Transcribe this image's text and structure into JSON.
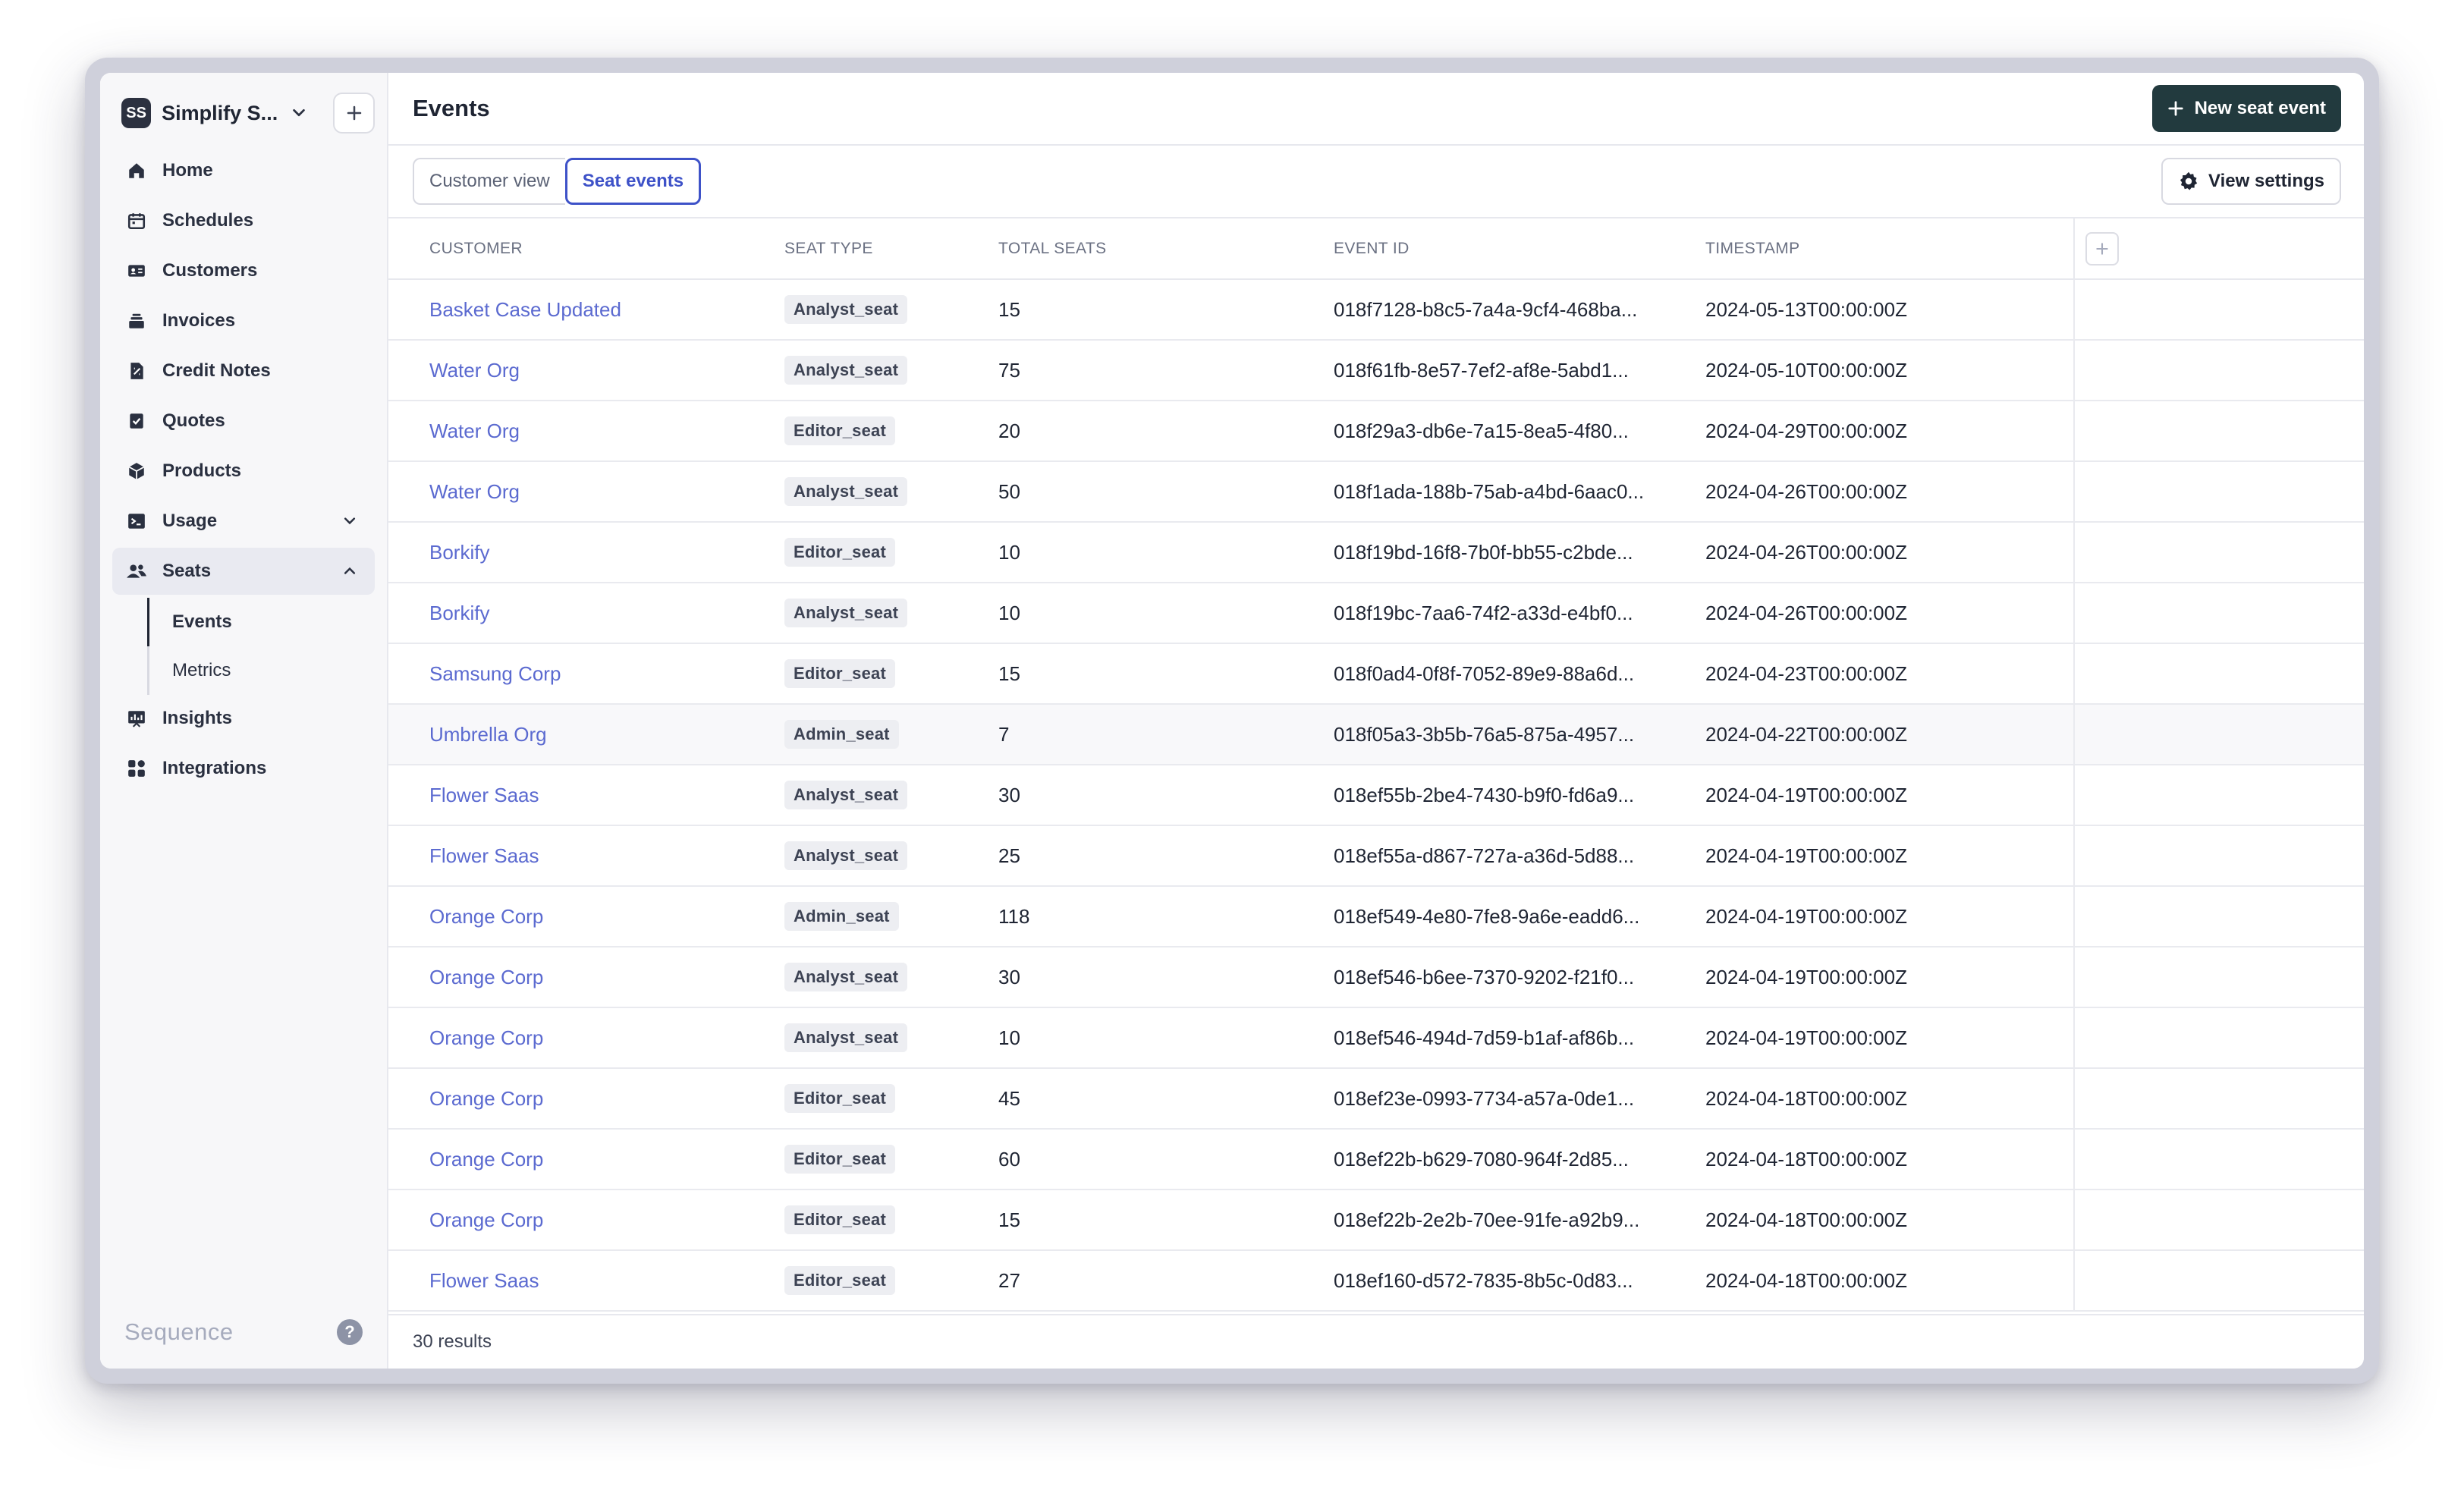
{
  "sidebar": {
    "org": {
      "initials": "SS",
      "name": "Simplify S..."
    },
    "items": [
      {
        "label": "Home",
        "icon": "home-icon"
      },
      {
        "label": "Schedules",
        "icon": "calendar-icon"
      },
      {
        "label": "Customers",
        "icon": "id-card-icon"
      },
      {
        "label": "Invoices",
        "icon": "invoice-stack-icon"
      },
      {
        "label": "Credit Notes",
        "icon": "credit-note-icon"
      },
      {
        "label": "Quotes",
        "icon": "quote-check-icon"
      },
      {
        "label": "Products",
        "icon": "box-icon"
      },
      {
        "label": "Usage",
        "icon": "terminal-icon"
      },
      {
        "label": "Seats",
        "icon": "users-icon"
      },
      {
        "label": "Insights",
        "icon": "chart-icon"
      },
      {
        "label": "Integrations",
        "icon": "grid-icon"
      }
    ],
    "seats_sub": [
      {
        "label": "Events"
      },
      {
        "label": "Metrics"
      }
    ],
    "brand": "Sequence",
    "help": "?"
  },
  "header": {
    "title": "Events",
    "new_button": "New seat event"
  },
  "toolbar": {
    "tabs": [
      {
        "label": "Customer view"
      },
      {
        "label": "Seat events"
      }
    ],
    "settings_label": "View settings"
  },
  "table": {
    "columns": [
      "CUSTOMER",
      "SEAT TYPE",
      "TOTAL SEATS",
      "EVENT ID",
      "TIMESTAMP"
    ],
    "rows": [
      {
        "customer": "Basket Case Updated",
        "seat_type": "Analyst_seat",
        "total": "15",
        "event_id": "018f7128-b8c5-7a4a-9cf4-468ba...",
        "timestamp": "2024-05-13T00:00:00Z"
      },
      {
        "customer": "Water Org",
        "seat_type": "Analyst_seat",
        "total": "75",
        "event_id": "018f61fb-8e57-7ef2-af8e-5abd1...",
        "timestamp": "2024-05-10T00:00:00Z"
      },
      {
        "customer": "Water Org",
        "seat_type": "Editor_seat",
        "total": "20",
        "event_id": "018f29a3-db6e-7a15-8ea5-4f80...",
        "timestamp": "2024-04-29T00:00:00Z"
      },
      {
        "customer": "Water Org",
        "seat_type": "Analyst_seat",
        "total": "50",
        "event_id": "018f1ada-188b-75ab-a4bd-6aac0...",
        "timestamp": "2024-04-26T00:00:00Z"
      },
      {
        "customer": "Borkify",
        "seat_type": "Editor_seat",
        "total": "10",
        "event_id": "018f19bd-16f8-7b0f-bb55-c2bde...",
        "timestamp": "2024-04-26T00:00:00Z"
      },
      {
        "customer": "Borkify",
        "seat_type": "Analyst_seat",
        "total": "10",
        "event_id": "018f19bc-7aa6-74f2-a33d-e4bf0...",
        "timestamp": "2024-04-26T00:00:00Z"
      },
      {
        "customer": "Samsung Corp",
        "seat_type": "Editor_seat",
        "total": "15",
        "event_id": "018f0ad4-0f8f-7052-89e9-88a6d...",
        "timestamp": "2024-04-23T00:00:00Z"
      },
      {
        "customer": "Umbrella Org",
        "seat_type": "Admin_seat",
        "total": "7",
        "event_id": "018f05a3-3b5b-76a5-875a-4957...",
        "timestamp": "2024-04-22T00:00:00Z"
      },
      {
        "customer": "Flower Saas",
        "seat_type": "Analyst_seat",
        "total": "30",
        "event_id": "018ef55b-2be4-7430-b9f0-fd6a9...",
        "timestamp": "2024-04-19T00:00:00Z"
      },
      {
        "customer": "Flower Saas",
        "seat_type": "Analyst_seat",
        "total": "25",
        "event_id": "018ef55a-d867-727a-a36d-5d88...",
        "timestamp": "2024-04-19T00:00:00Z"
      },
      {
        "customer": "Orange Corp",
        "seat_type": "Admin_seat",
        "total": "118",
        "event_id": "018ef549-4e80-7fe8-9a6e-eadd6...",
        "timestamp": "2024-04-19T00:00:00Z"
      },
      {
        "customer": "Orange Corp",
        "seat_type": "Analyst_seat",
        "total": "30",
        "event_id": "018ef546-b6ee-7370-9202-f21f0...",
        "timestamp": "2024-04-19T00:00:00Z"
      },
      {
        "customer": "Orange Corp",
        "seat_type": "Analyst_seat",
        "total": "10",
        "event_id": "018ef546-494d-7d59-b1af-af86b...",
        "timestamp": "2024-04-19T00:00:00Z"
      },
      {
        "customer": "Orange Corp",
        "seat_type": "Editor_seat",
        "total": "45",
        "event_id": "018ef23e-0993-7734-a57a-0de1...",
        "timestamp": "2024-04-18T00:00:00Z"
      },
      {
        "customer": "Orange Corp",
        "seat_type": "Editor_seat",
        "total": "60",
        "event_id": "018ef22b-b629-7080-964f-2d85...",
        "timestamp": "2024-04-18T00:00:00Z"
      },
      {
        "customer": "Orange Corp",
        "seat_type": "Editor_seat",
        "total": "15",
        "event_id": "018ef22b-2e2b-70ee-91fe-a92b9...",
        "timestamp": "2024-04-18T00:00:00Z"
      },
      {
        "customer": "Flower Saas",
        "seat_type": "Editor_seat",
        "total": "27",
        "event_id": "018ef160-d572-7835-8b5c-0d83...",
        "timestamp": "2024-04-18T00:00:00Z"
      }
    ],
    "results": "30 results"
  },
  "colors": {
    "primary": "#223a3e",
    "link": "#5b6ad0",
    "accent": "#3e52c8"
  }
}
